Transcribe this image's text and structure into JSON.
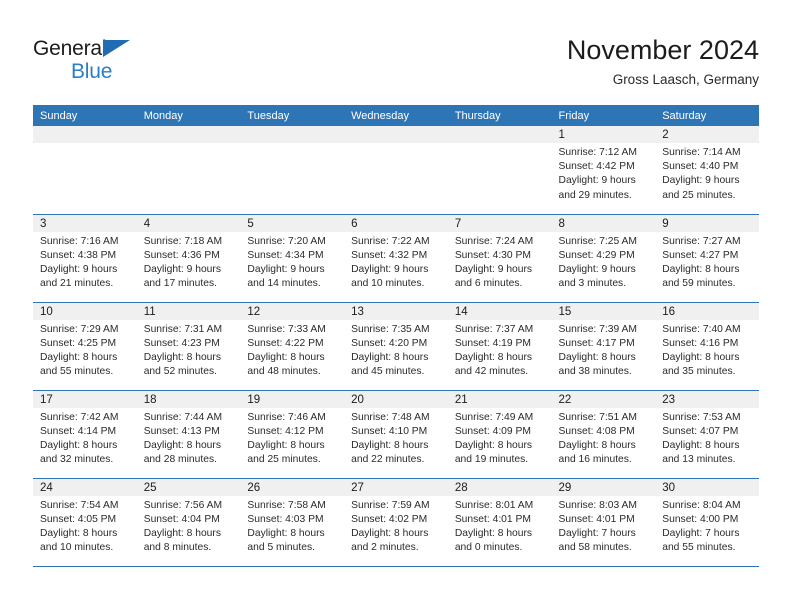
{
  "brand": {
    "name_top": "General",
    "name_bottom": "Blue",
    "triangle_color": "#1f6cb4",
    "blue_color": "#2a7fc9"
  },
  "header": {
    "title": "November 2024",
    "subtitle": "Gross Laasch, Germany"
  },
  "theme": {
    "header_row_bg": "#2e75b6",
    "date_band_bg": "#f0f0f0",
    "row_divider": "#2e75b6",
    "text": "#2b2b2b"
  },
  "weekday_headers": [
    "Sunday",
    "Monday",
    "Tuesday",
    "Wednesday",
    "Thursday",
    "Friday",
    "Saturday"
  ],
  "weeks": [
    [
      {
        "day": "",
        "empty": true
      },
      {
        "day": "",
        "empty": true
      },
      {
        "day": "",
        "empty": true
      },
      {
        "day": "",
        "empty": true
      },
      {
        "day": "",
        "empty": true
      },
      {
        "day": "1",
        "sunrise": "Sunrise: 7:12 AM",
        "sunset": "Sunset: 4:42 PM",
        "daylight_1": "Daylight: 9 hours",
        "daylight_2": "and 29 minutes."
      },
      {
        "day": "2",
        "sunrise": "Sunrise: 7:14 AM",
        "sunset": "Sunset: 4:40 PM",
        "daylight_1": "Daylight: 9 hours",
        "daylight_2": "and 25 minutes."
      }
    ],
    [
      {
        "day": "3",
        "sunrise": "Sunrise: 7:16 AM",
        "sunset": "Sunset: 4:38 PM",
        "daylight_1": "Daylight: 9 hours",
        "daylight_2": "and 21 minutes."
      },
      {
        "day": "4",
        "sunrise": "Sunrise: 7:18 AM",
        "sunset": "Sunset: 4:36 PM",
        "daylight_1": "Daylight: 9 hours",
        "daylight_2": "and 17 minutes."
      },
      {
        "day": "5",
        "sunrise": "Sunrise: 7:20 AM",
        "sunset": "Sunset: 4:34 PM",
        "daylight_1": "Daylight: 9 hours",
        "daylight_2": "and 14 minutes."
      },
      {
        "day": "6",
        "sunrise": "Sunrise: 7:22 AM",
        "sunset": "Sunset: 4:32 PM",
        "daylight_1": "Daylight: 9 hours",
        "daylight_2": "and 10 minutes."
      },
      {
        "day": "7",
        "sunrise": "Sunrise: 7:24 AM",
        "sunset": "Sunset: 4:30 PM",
        "daylight_1": "Daylight: 9 hours",
        "daylight_2": "and 6 minutes."
      },
      {
        "day": "8",
        "sunrise": "Sunrise: 7:25 AM",
        "sunset": "Sunset: 4:29 PM",
        "daylight_1": "Daylight: 9 hours",
        "daylight_2": "and 3 minutes."
      },
      {
        "day": "9",
        "sunrise": "Sunrise: 7:27 AM",
        "sunset": "Sunset: 4:27 PM",
        "daylight_1": "Daylight: 8 hours",
        "daylight_2": "and 59 minutes."
      }
    ],
    [
      {
        "day": "10",
        "sunrise": "Sunrise: 7:29 AM",
        "sunset": "Sunset: 4:25 PM",
        "daylight_1": "Daylight: 8 hours",
        "daylight_2": "and 55 minutes."
      },
      {
        "day": "11",
        "sunrise": "Sunrise: 7:31 AM",
        "sunset": "Sunset: 4:23 PM",
        "daylight_1": "Daylight: 8 hours",
        "daylight_2": "and 52 minutes."
      },
      {
        "day": "12",
        "sunrise": "Sunrise: 7:33 AM",
        "sunset": "Sunset: 4:22 PM",
        "daylight_1": "Daylight: 8 hours",
        "daylight_2": "and 48 minutes."
      },
      {
        "day": "13",
        "sunrise": "Sunrise: 7:35 AM",
        "sunset": "Sunset: 4:20 PM",
        "daylight_1": "Daylight: 8 hours",
        "daylight_2": "and 45 minutes."
      },
      {
        "day": "14",
        "sunrise": "Sunrise: 7:37 AM",
        "sunset": "Sunset: 4:19 PM",
        "daylight_1": "Daylight: 8 hours",
        "daylight_2": "and 42 minutes."
      },
      {
        "day": "15",
        "sunrise": "Sunrise: 7:39 AM",
        "sunset": "Sunset: 4:17 PM",
        "daylight_1": "Daylight: 8 hours",
        "daylight_2": "and 38 minutes."
      },
      {
        "day": "16",
        "sunrise": "Sunrise: 7:40 AM",
        "sunset": "Sunset: 4:16 PM",
        "daylight_1": "Daylight: 8 hours",
        "daylight_2": "and 35 minutes."
      }
    ],
    [
      {
        "day": "17",
        "sunrise": "Sunrise: 7:42 AM",
        "sunset": "Sunset: 4:14 PM",
        "daylight_1": "Daylight: 8 hours",
        "daylight_2": "and 32 minutes."
      },
      {
        "day": "18",
        "sunrise": "Sunrise: 7:44 AM",
        "sunset": "Sunset: 4:13 PM",
        "daylight_1": "Daylight: 8 hours",
        "daylight_2": "and 28 minutes."
      },
      {
        "day": "19",
        "sunrise": "Sunrise: 7:46 AM",
        "sunset": "Sunset: 4:12 PM",
        "daylight_1": "Daylight: 8 hours",
        "daylight_2": "and 25 minutes."
      },
      {
        "day": "20",
        "sunrise": "Sunrise: 7:48 AM",
        "sunset": "Sunset: 4:10 PM",
        "daylight_1": "Daylight: 8 hours",
        "daylight_2": "and 22 minutes."
      },
      {
        "day": "21",
        "sunrise": "Sunrise: 7:49 AM",
        "sunset": "Sunset: 4:09 PM",
        "daylight_1": "Daylight: 8 hours",
        "daylight_2": "and 19 minutes."
      },
      {
        "day": "22",
        "sunrise": "Sunrise: 7:51 AM",
        "sunset": "Sunset: 4:08 PM",
        "daylight_1": "Daylight: 8 hours",
        "daylight_2": "and 16 minutes."
      },
      {
        "day": "23",
        "sunrise": "Sunrise: 7:53 AM",
        "sunset": "Sunset: 4:07 PM",
        "daylight_1": "Daylight: 8 hours",
        "daylight_2": "and 13 minutes."
      }
    ],
    [
      {
        "day": "24",
        "sunrise": "Sunrise: 7:54 AM",
        "sunset": "Sunset: 4:05 PM",
        "daylight_1": "Daylight: 8 hours",
        "daylight_2": "and 10 minutes."
      },
      {
        "day": "25",
        "sunrise": "Sunrise: 7:56 AM",
        "sunset": "Sunset: 4:04 PM",
        "daylight_1": "Daylight: 8 hours",
        "daylight_2": "and 8 minutes."
      },
      {
        "day": "26",
        "sunrise": "Sunrise: 7:58 AM",
        "sunset": "Sunset: 4:03 PM",
        "daylight_1": "Daylight: 8 hours",
        "daylight_2": "and 5 minutes."
      },
      {
        "day": "27",
        "sunrise": "Sunrise: 7:59 AM",
        "sunset": "Sunset: 4:02 PM",
        "daylight_1": "Daylight: 8 hours",
        "daylight_2": "and 2 minutes."
      },
      {
        "day": "28",
        "sunrise": "Sunrise: 8:01 AM",
        "sunset": "Sunset: 4:01 PM",
        "daylight_1": "Daylight: 8 hours",
        "daylight_2": "and 0 minutes."
      },
      {
        "day": "29",
        "sunrise": "Sunrise: 8:03 AM",
        "sunset": "Sunset: 4:01 PM",
        "daylight_1": "Daylight: 7 hours",
        "daylight_2": "and 58 minutes."
      },
      {
        "day": "30",
        "sunrise": "Sunrise: 8:04 AM",
        "sunset": "Sunset: 4:00 PM",
        "daylight_1": "Daylight: 7 hours",
        "daylight_2": "and 55 minutes."
      }
    ]
  ]
}
